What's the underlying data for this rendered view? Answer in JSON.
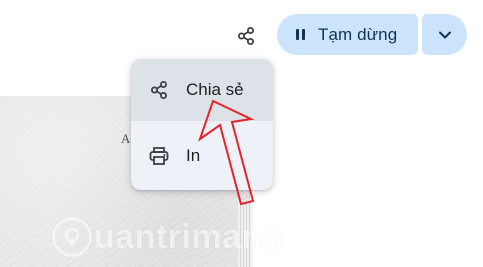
{
  "toolbar": {
    "share_icon": "share-icon",
    "pause_icon": "pause-icon",
    "pause_label": "Tạm dừng",
    "dropdown_icon": "chevron-down-icon",
    "accent_color": "#cce4fb",
    "accent_text_color": "#14305a"
  },
  "menu": {
    "items": [
      {
        "icon": "share-icon",
        "label": "Chia sẻ",
        "highlighted": true
      },
      {
        "icon": "printer-icon",
        "label": "In",
        "highlighted": false
      }
    ]
  },
  "document": {
    "visible_letter": "A"
  },
  "annotation": {
    "arrow_color": "#e8232b"
  },
  "watermark": {
    "text": "uantrimang"
  }
}
